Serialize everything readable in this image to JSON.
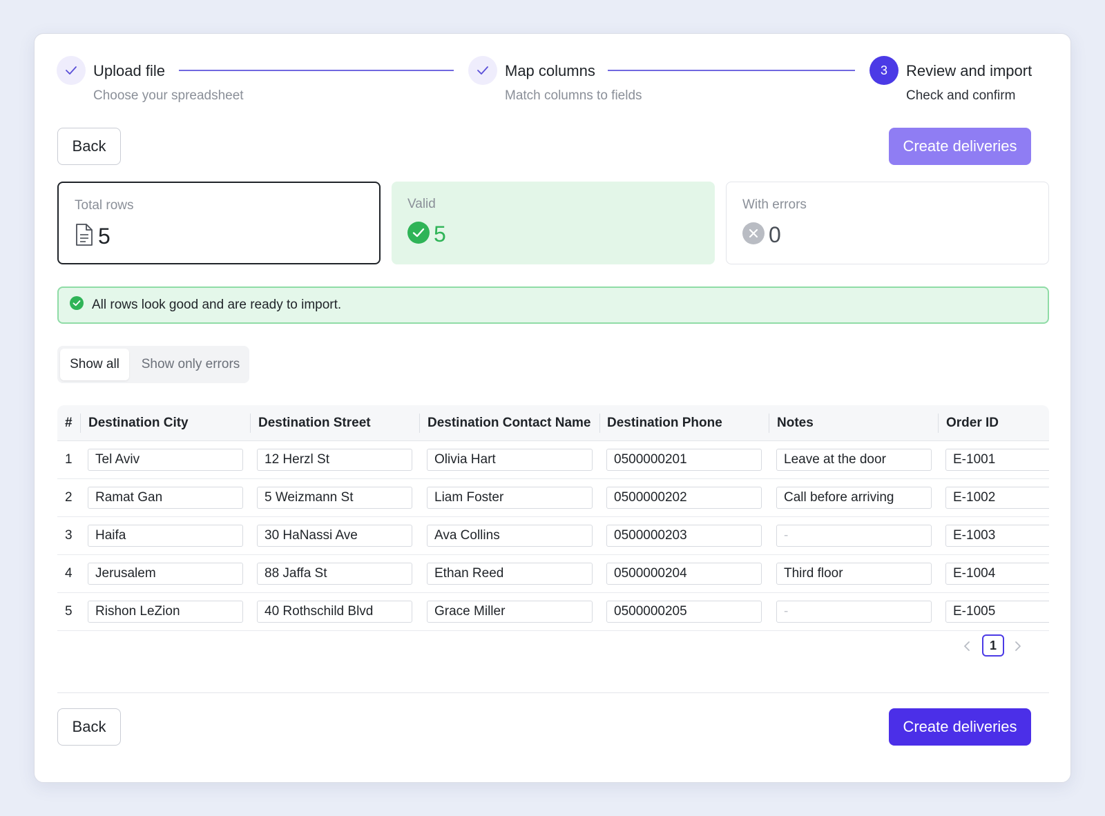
{
  "stepper": {
    "steps": [
      {
        "title": "Upload file",
        "subtitle": "Choose your spreadsheet",
        "state": "done"
      },
      {
        "title": "Map columns",
        "subtitle": "Match columns to fields",
        "state": "done"
      },
      {
        "title": "Review and import",
        "subtitle": "Check and confirm",
        "state": "active",
        "number": "3"
      }
    ]
  },
  "actions": {
    "back_label": "Back",
    "create_label": "Create deliveries"
  },
  "stats": {
    "total": {
      "label": "Total rows",
      "value": "5"
    },
    "valid": {
      "label": "Valid",
      "value": "5"
    },
    "errors": {
      "label": "With errors",
      "value": "0"
    }
  },
  "banner": {
    "text": "All rows look good and are ready to import."
  },
  "filter": {
    "show_all": "Show all",
    "show_errors": "Show only errors",
    "selected": "Show all"
  },
  "table": {
    "columns": [
      "#",
      "Destination City",
      "Destination Street",
      "Destination Contact Name",
      "Destination Phone",
      "Notes",
      "Order ID"
    ],
    "rows": [
      {
        "num": "1",
        "city": "Tel Aviv",
        "street": "12 Herzl St",
        "contact": "Olivia Hart",
        "phone": "0500000201",
        "notes": "Leave at the door",
        "order": "E-1001"
      },
      {
        "num": "2",
        "city": "Ramat Gan",
        "street": "5 Weizmann St",
        "contact": "Liam Foster",
        "phone": "0500000202",
        "notes": "Call before arriving",
        "order": "E-1002"
      },
      {
        "num": "3",
        "city": "Haifa",
        "street": "30 HaNassi Ave",
        "contact": "Ava Collins",
        "phone": "0500000203",
        "notes": "-",
        "order": "E-1003"
      },
      {
        "num": "4",
        "city": "Jerusalem",
        "street": "88 Jaffa St",
        "contact": "Ethan Reed",
        "phone": "0500000204",
        "notes": "Third floor",
        "order": "E-1004"
      },
      {
        "num": "5",
        "city": "Rishon LeZion",
        "street": "40 Rothschild Blvd",
        "contact": "Grace Miller",
        "phone": "0500000205",
        "notes": "-",
        "order": "E-1005"
      }
    ]
  },
  "pagination": {
    "current": "1",
    "prev_icon": "chevron-left-icon",
    "next_icon": "chevron-right-icon"
  },
  "colors": {
    "accent": "#4b2fe8",
    "accent_light": "#8f7df3",
    "success": "#2fb457",
    "success_bg": "#e3f6e8",
    "neutral_icon": "#b9bcc3"
  }
}
